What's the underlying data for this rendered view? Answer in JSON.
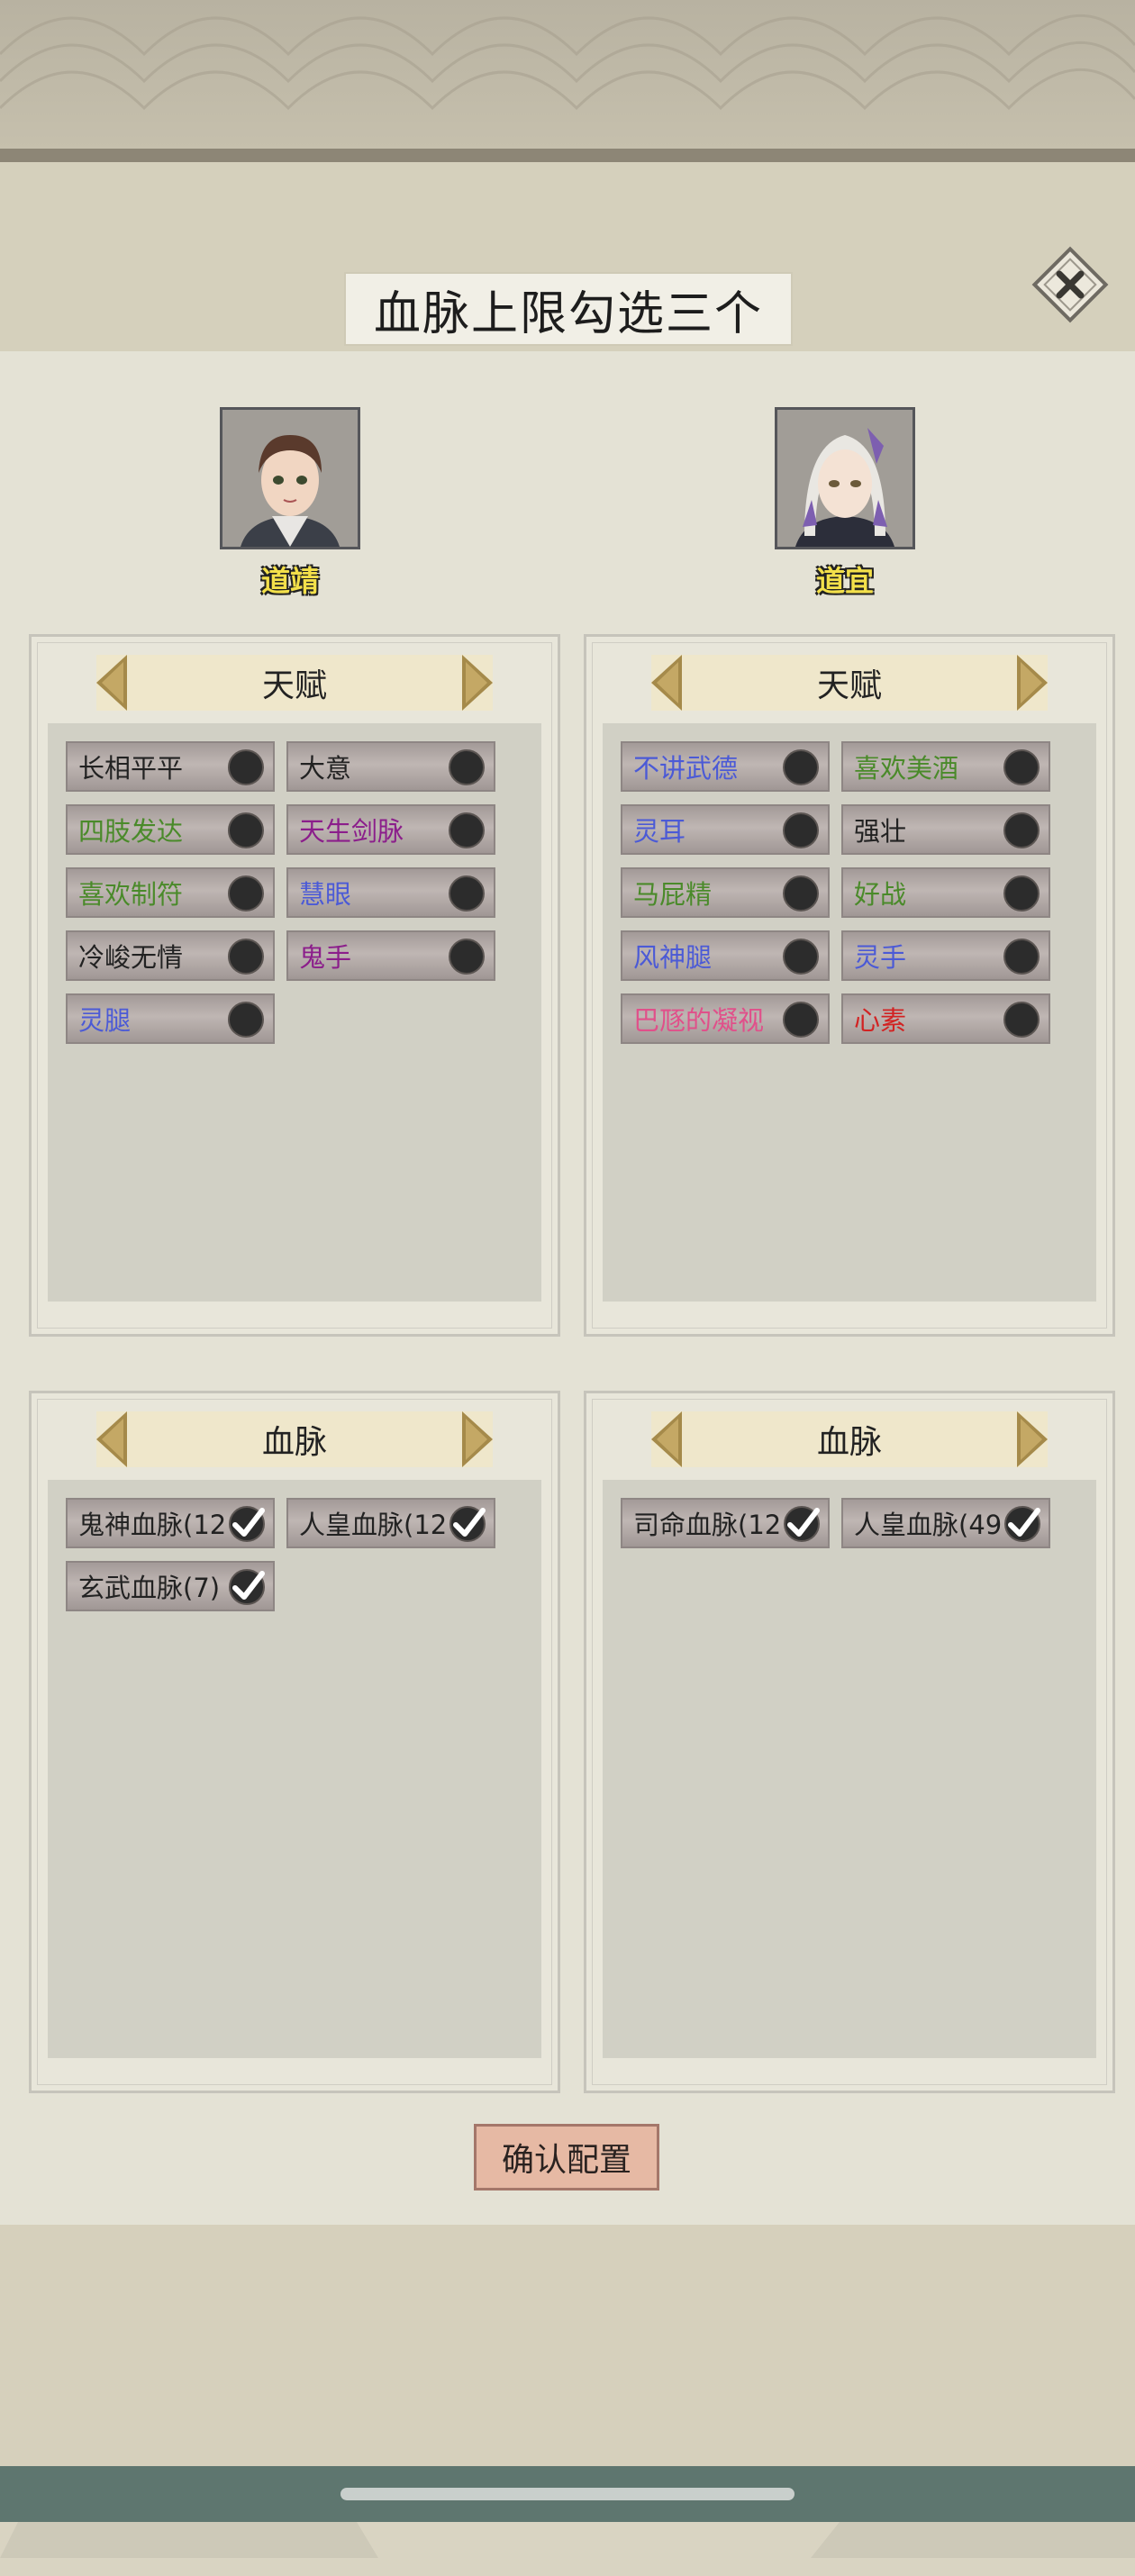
{
  "title": "血脉上限勾选三个",
  "close_icon": "close-x-icon",
  "characters": [
    {
      "name": "道靖"
    },
    {
      "name": "道宜"
    }
  ],
  "talent_panels": [
    {
      "header": "天赋",
      "items": [
        {
          "label": "长相平平",
          "color": "#222222",
          "icon": "toggle-dot-icon"
        },
        {
          "label": "大意",
          "color": "#222222",
          "icon": "toggle-dot-icon"
        },
        {
          "label": "四肢发达",
          "color": "#4a8a2a",
          "icon": "toggle-dot-icon"
        },
        {
          "label": "天生剑脉",
          "color": "#8b1e8b",
          "icon": "toggle-dot-icon"
        },
        {
          "label": "喜欢制符",
          "color": "#4a8a2a",
          "icon": "toggle-dot-icon"
        },
        {
          "label": "慧眼",
          "color": "#4b5ad6",
          "icon": "toggle-dot-icon"
        },
        {
          "label": "冷峻无情",
          "color": "#222222",
          "icon": "toggle-dot-icon"
        },
        {
          "label": "鬼手",
          "color": "#8b1e8b",
          "icon": "toggle-dot-icon"
        },
        {
          "label": "灵腿",
          "color": "#4b5ad6",
          "icon": "toggle-dot-icon"
        }
      ]
    },
    {
      "header": "天赋",
      "items": [
        {
          "label": "不讲武德",
          "color": "#4b5ad6",
          "icon": "toggle-dot-icon"
        },
        {
          "label": "喜欢美酒",
          "color": "#4a8a2a",
          "icon": "toggle-dot-icon"
        },
        {
          "label": "灵耳",
          "color": "#4b5ad6",
          "icon": "toggle-dot-icon"
        },
        {
          "label": "强壮",
          "color": "#222222",
          "icon": "toggle-dot-icon"
        },
        {
          "label": "马屁精",
          "color": "#4a8a2a",
          "icon": "toggle-dot-icon"
        },
        {
          "label": "好战",
          "color": "#4a8a2a",
          "icon": "toggle-dot-icon"
        },
        {
          "label": "风神腿",
          "color": "#4b5ad6",
          "icon": "toggle-dot-icon"
        },
        {
          "label": "灵手",
          "color": "#4b5ad6",
          "icon": "toggle-dot-icon"
        },
        {
          "label": "巴豗的凝视",
          "color": "#e0508a",
          "icon": "toggle-dot-icon"
        },
        {
          "label": "心素",
          "color": "#d22222",
          "icon": "toggle-dot-icon"
        }
      ]
    }
  ],
  "bloodline_panels": [
    {
      "header": "血脉",
      "items": [
        {
          "label": "鬼神血脉(12",
          "color": "#222222",
          "icon": "checkmark-icon"
        },
        {
          "label": "人皇血脉(12",
          "color": "#222222",
          "icon": "checkmark-icon"
        },
        {
          "label": "玄武血脉(7)",
          "color": "#222222",
          "icon": "checkmark-icon"
        }
      ]
    },
    {
      "header": "血脉",
      "items": [
        {
          "label": "司命血脉(12",
          "color": "#222222",
          "icon": "checkmark-icon"
        },
        {
          "label": "人皇血脉(49",
          "color": "#222222",
          "icon": "checkmark-icon"
        }
      ]
    }
  ],
  "confirm_label": "确认配置"
}
